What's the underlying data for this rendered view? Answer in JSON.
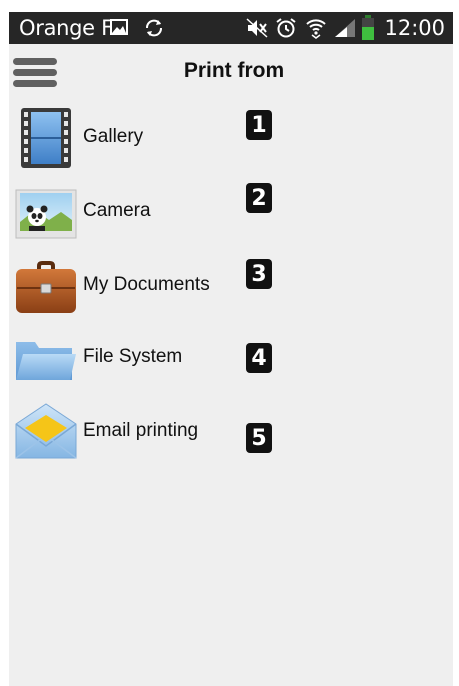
{
  "status_bar": {
    "carrier": "Orange F",
    "time": "12:00",
    "icons": [
      "image-icon",
      "sync-icon",
      "mute-icon",
      "alarm-icon",
      "wifi-icon",
      "signal-icon",
      "battery-icon"
    ]
  },
  "header": {
    "title": "Print from",
    "menu_icon": "hamburger-menu-icon"
  },
  "items": [
    {
      "label": "Gallery",
      "icon": "film-strip-icon",
      "badge": "1"
    },
    {
      "label": "Camera",
      "icon": "panda-photo-icon",
      "badge": "2"
    },
    {
      "label": "My Documents",
      "icon": "briefcase-icon",
      "badge": "3"
    },
    {
      "label": "File System",
      "icon": "folder-icon",
      "badge": "4"
    },
    {
      "label": "Email printing",
      "icon": "envelope-icon",
      "badge": "5"
    }
  ],
  "colors": {
    "background": "#efefef",
    "status_bar": "#262626",
    "menu_bars": "#606060",
    "badge": "#111111"
  }
}
